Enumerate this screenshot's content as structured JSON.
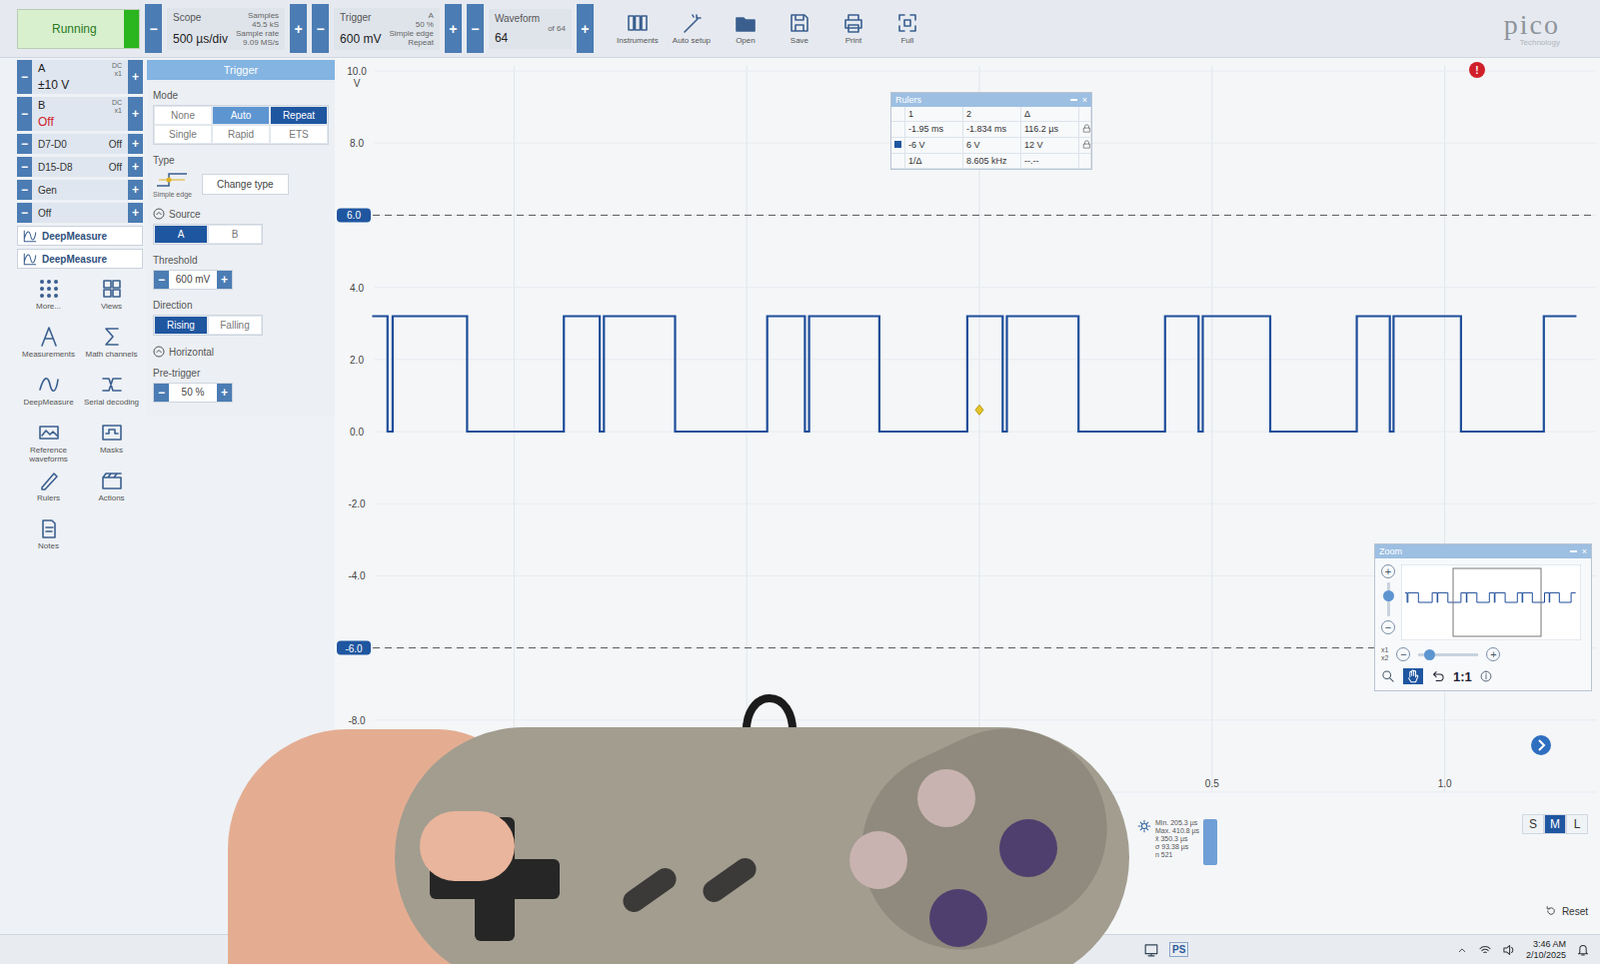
{
  "toolbar": {
    "run": {
      "label": "Running",
      "on": true
    },
    "minus": "−",
    "plus": "+",
    "scope": {
      "label": "Scope",
      "value": "500 µs/div",
      "mini": [
        "Samples",
        "45.5 kS",
        "Sample rate",
        "9.09 MS/s"
      ]
    },
    "trigger": {
      "label": "Trigger",
      "value": "600 mV",
      "mini": [
        "A",
        "50 %",
        "Simple edge",
        "Repeat"
      ]
    },
    "waveform": {
      "label": "Waveform",
      "value": "64",
      "of": "of 64"
    },
    "tools": [
      "Instruments",
      "Auto setup",
      "Open",
      "Save",
      "Print",
      "Full"
    ]
  },
  "logo": {
    "text": "pico",
    "sub": "Technology"
  },
  "alert": "!",
  "channels": [
    {
      "name": "A",
      "coupling": "DC",
      "probe": "x1",
      "range": "±10 V",
      "enabled": true
    },
    {
      "name": "B",
      "coupling": "DC",
      "probe": "x1",
      "range": "Off",
      "enabled": false
    }
  ],
  "digital": [
    {
      "name": "D7-D0",
      "state": "Off"
    },
    {
      "name": "D15-D8",
      "state": "Off"
    }
  ],
  "generator": {
    "name": "Gen",
    "state": "Off"
  },
  "deepmeasure": [
    "DeepMeasure",
    "DeepMeasure"
  ],
  "tools": [
    "More...",
    "Views",
    "Measurements",
    "Math channels",
    "DeepMeasure",
    "Serial decoding",
    "Reference waveforms",
    "Masks",
    "Rulers",
    "Actions",
    "Notes"
  ],
  "trigger_panel": {
    "title": "Trigger",
    "mode_label": "Mode",
    "modes": [
      {
        "label": "None",
        "selected": false,
        "hovered": false
      },
      {
        "label": "Auto",
        "selected": false,
        "hovered": true
      },
      {
        "label": "Repeat",
        "selected": true,
        "hovered": false
      },
      {
        "label": "Single",
        "selected": false,
        "hovered": false
      },
      {
        "label": "Rapid",
        "selected": false,
        "hovered": false
      },
      {
        "label": "ETS",
        "selected": false,
        "hovered": false
      }
    ],
    "type_label": "Type",
    "type_caption": "Simple edge",
    "change_type": "Change type",
    "source_label": "Source",
    "sources": [
      {
        "label": "A",
        "selected": true
      },
      {
        "label": "B",
        "selected": false
      }
    ],
    "threshold_label": "Threshold",
    "threshold": "600 mV",
    "direction_label": "Direction",
    "directions": [
      {
        "label": "Rising",
        "selected": true
      },
      {
        "label": "Falling",
        "selected": false
      }
    ],
    "horizontal_label": "Horizontal",
    "pretrigger_label": "Pre-trigger",
    "pretrigger": "50 %"
  },
  "chart": {
    "unit": "V",
    "y_ticks": [
      {
        "label": "10.0",
        "value": 10
      },
      {
        "label": "8.0",
        "value": 8
      },
      {
        "label": "4.0",
        "value": 4
      },
      {
        "label": "2.0",
        "value": 2
      },
      {
        "label": "0.0",
        "value": 0
      },
      {
        "label": "-2.0",
        "value": -2
      },
      {
        "label": "-4.0",
        "value": -4
      },
      {
        "label": "-8.0",
        "value": -8
      }
    ],
    "ruler_markers": [
      {
        "label": "6.0",
        "value": 6
      },
      {
        "label": "-6.0",
        "value": -6
      }
    ],
    "x_ticks": [
      {
        "label": "0.5",
        "value": 0.5
      },
      {
        "label": "1.0",
        "value": 1
      }
    ],
    "series": [
      {
        "name": "A",
        "times": [
          -1.305,
          -1.272,
          -1.261,
          -1.101,
          -0.893,
          -0.816,
          -0.807,
          -0.654,
          -0.456,
          -0.375,
          -0.366,
          -0.215,
          -0.026,
          0.05,
          0.059,
          0.213,
          0.399,
          0.471,
          0.48,
          0.625,
          0.811,
          0.882,
          0.89,
          1.035,
          1.213,
          1.283
        ],
        "values": [
          3.2,
          0,
          3.2,
          0,
          3.2,
          0,
          3.2,
          0,
          3.2,
          0,
          3.2,
          0,
          3.2,
          0,
          3.2,
          0,
          3.2,
          0,
          3.2,
          0,
          3.2,
          0,
          3.2,
          0,
          3.2
        ]
      }
    ],
    "trigger_marker": {
      "time": 0,
      "level": 0.6
    }
  },
  "rulers": {
    "title": "Rulers",
    "close": "×",
    "columns": [
      "1",
      "2",
      "Δ"
    ],
    "rows": [
      [
        "-1.95 ms",
        "-1.834 ms",
        "116.2 µs"
      ],
      [
        "-6 V",
        "6 V",
        "12 V"
      ]
    ],
    "inverse": [
      "1/Δ",
      "8.605 kHz",
      "--.--"
    ]
  },
  "zoom": {
    "title": "Zoom",
    "close": "×",
    "scales": [
      "x1",
      "x2"
    ],
    "reset": "1:1"
  },
  "stats": [
    "Min. 205.3 µs",
    "Max. 410.8 µs",
    "x̄ 350.3 µs",
    "σ 93.38 µs",
    "n 521"
  ],
  "size_buttons": [
    {
      "label": "S",
      "selected": false
    },
    {
      "label": "M",
      "selected": true
    },
    {
      "label": "L",
      "selected": false
    }
  ],
  "reset": "Reset",
  "taskbar": {
    "app": "PS",
    "time": "3:46 AM",
    "date": "2/10/2025"
  }
}
